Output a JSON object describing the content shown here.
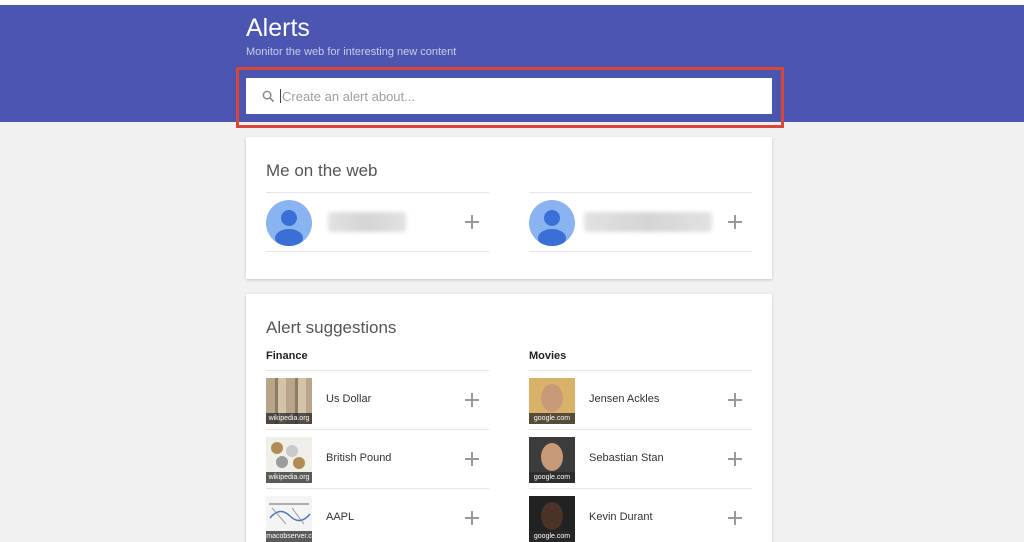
{
  "header": {
    "title": "Alerts",
    "subtitle": "Monitor the web for interesting new content"
  },
  "search": {
    "placeholder": "Create an alert about..."
  },
  "me_on_web": {
    "title": "Me on the web"
  },
  "suggestions": {
    "title": "Alert suggestions",
    "finance": {
      "label": "Finance",
      "items": [
        {
          "label": "Us Dollar",
          "source": "wikipedia.org"
        },
        {
          "label": "British Pound",
          "source": "wikipedia.org"
        },
        {
          "label": "AAPL",
          "source": "macobserver.c"
        }
      ]
    },
    "movies": {
      "label": "Movies",
      "items": [
        {
          "label": "Jensen Ackles",
          "source": "google.com"
        },
        {
          "label": "Sebastian Stan",
          "source": "google.com"
        },
        {
          "label": "Kevin Durant",
          "source": "google.com"
        }
      ]
    }
  },
  "colors": {
    "header_bg": "#4a56b0",
    "highlight": "#d9463a",
    "avatar": "#8ab4f0"
  }
}
